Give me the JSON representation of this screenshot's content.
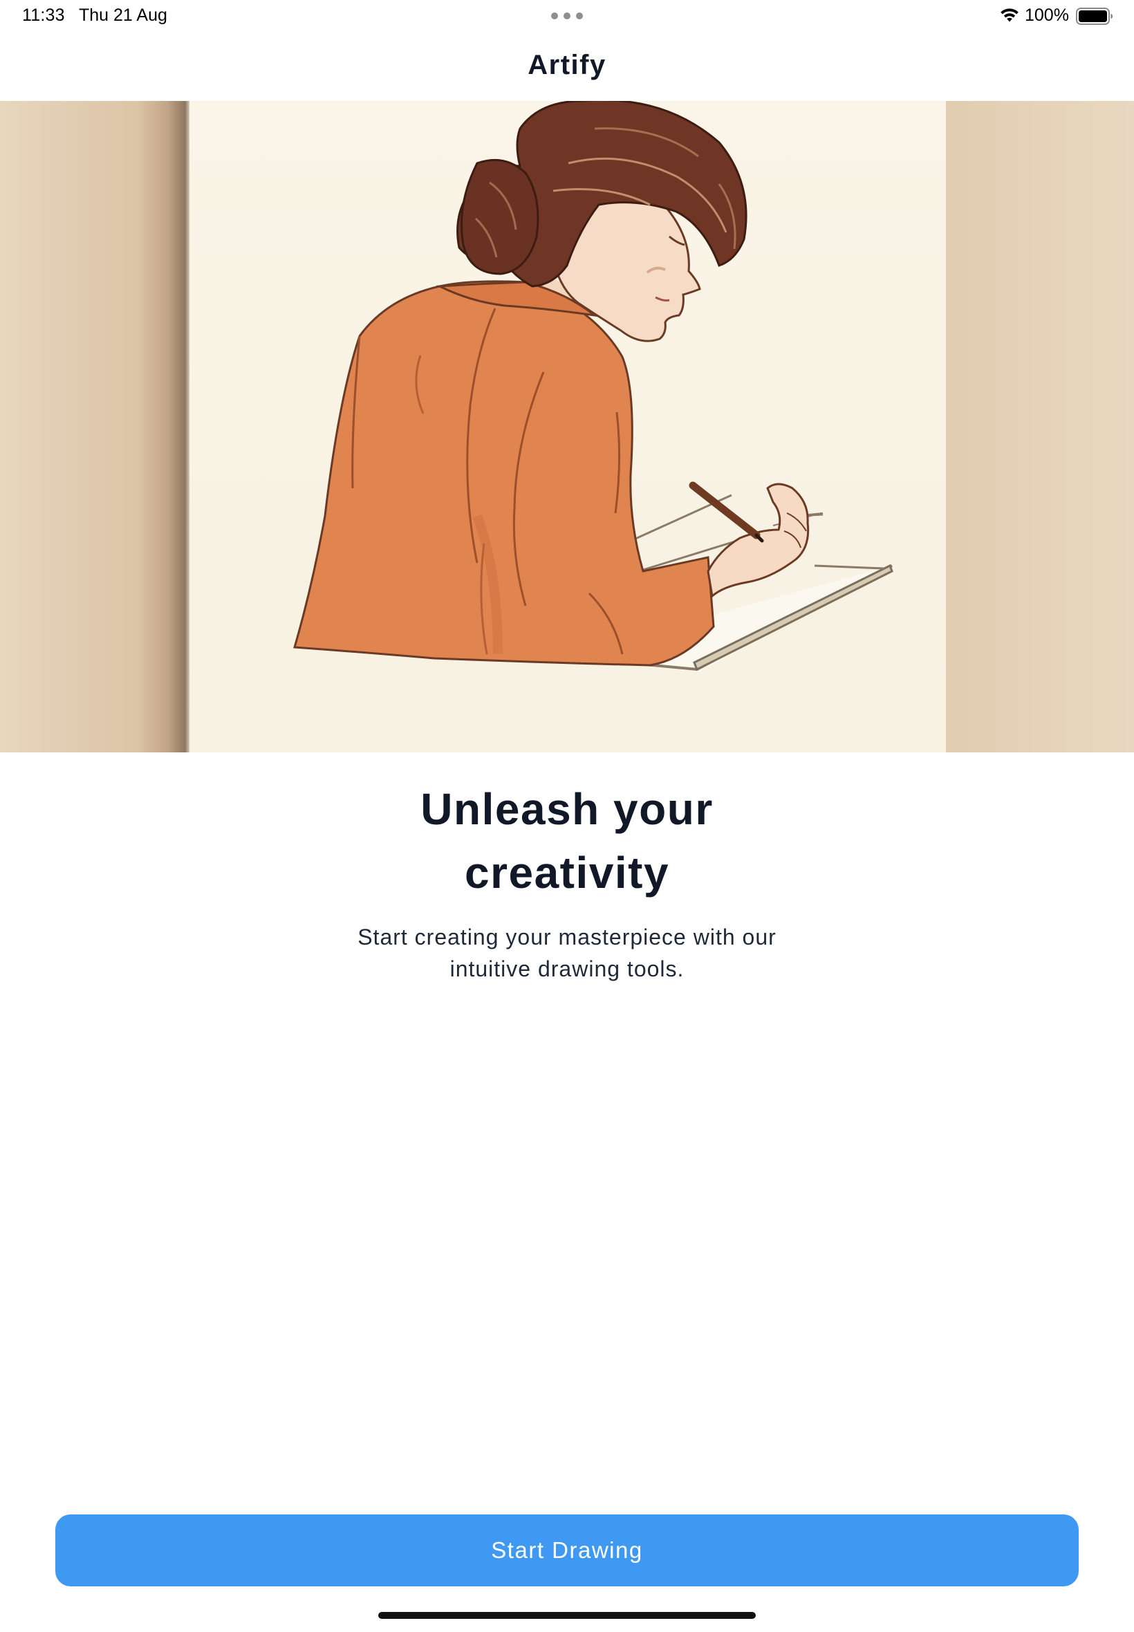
{
  "status_bar": {
    "time": "11:33",
    "date": "Thu 21 Aug",
    "battery_percent": "100%",
    "battery_level": 1.0,
    "icons": [
      "wifi-icon",
      "battery-icon",
      "multitask-dots-icon"
    ]
  },
  "header": {
    "title": "Artify"
  },
  "hero": {
    "image_name": "woman-drawing-illustration"
  },
  "content": {
    "headline_line1": "Unleash your",
    "headline_line2": "creativity",
    "subtitle_line1": "Start creating your masterpiece with our",
    "subtitle_line2": "intuitive drawing tools."
  },
  "cta": {
    "label": "Start Drawing"
  },
  "colors": {
    "accent": "#3f99f2",
    "text_primary": "#111827",
    "background": "#ffffff",
    "hero_wall": "#e6d3bb",
    "hero_paper": "#f9f4e7",
    "sweater": "#e0854f",
    "hair": "#6f3525"
  }
}
